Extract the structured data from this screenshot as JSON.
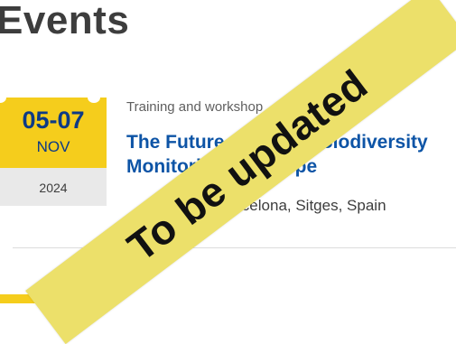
{
  "page": {
    "title": "Events"
  },
  "event": {
    "date": {
      "days": "05-07",
      "month": "NOV",
      "year": "2024"
    },
    "type": "Training and workshop",
    "title": "The Future of Marine Biodiversity\nMonitoring in Europe",
    "location": "Meliá Barcelona, Sitges, Spain"
  },
  "overlay": {
    "text": "To be updated"
  },
  "colors": {
    "accent_yellow": "#f5cd1c",
    "link_blue": "#0d54a6",
    "date_blue": "#0d3a86",
    "banner": "#ece06a"
  }
}
